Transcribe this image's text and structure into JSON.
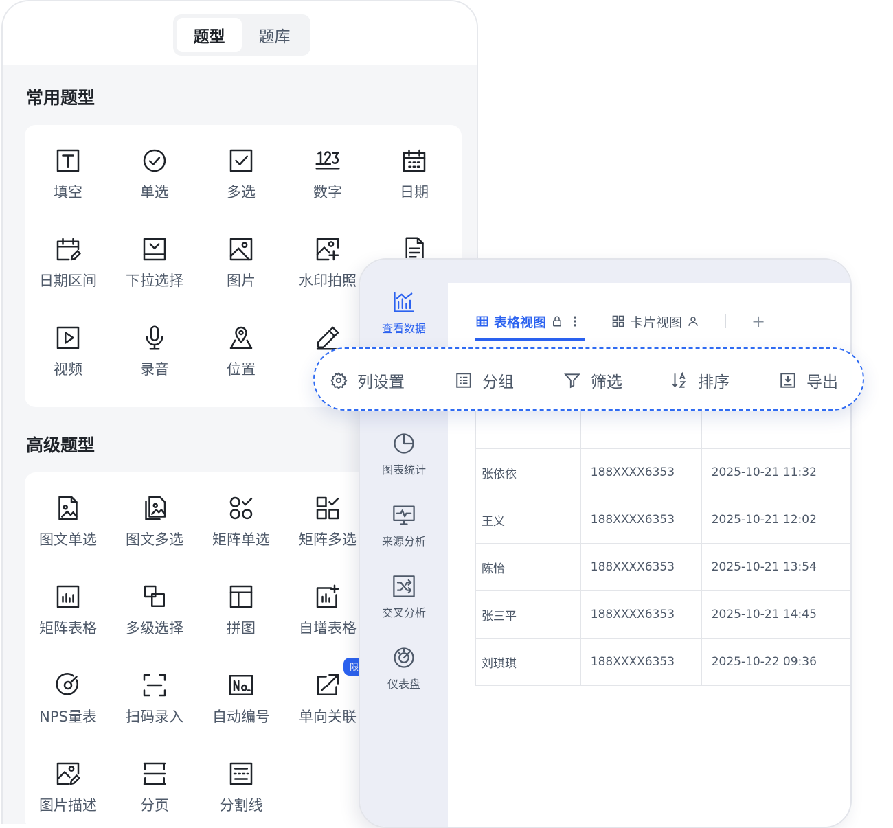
{
  "segmented": [
    "题型",
    "题库"
  ],
  "common": {
    "title": "常用题型",
    "items": [
      {
        "label": "填空",
        "icon": "text-icon"
      },
      {
        "label": "单选",
        "icon": "radio-check-icon"
      },
      {
        "label": "多选",
        "icon": "checkbox-icon"
      },
      {
        "label": "数字",
        "icon": "number-123-icon"
      },
      {
        "label": "日期",
        "icon": "calendar-icon"
      },
      {
        "label": "日期区间",
        "icon": "calendar-edit-icon"
      },
      {
        "label": "下拉选择",
        "icon": "dropdown-icon"
      },
      {
        "label": "图片",
        "icon": "image-icon"
      },
      {
        "label": "水印拍照",
        "icon": "watermark-photo-icon"
      },
      {
        "label": "",
        "icon": "document-icon"
      },
      {
        "label": "视频",
        "icon": "video-icon"
      },
      {
        "label": "录音",
        "icon": "microphone-icon"
      },
      {
        "label": "位置",
        "icon": "location-icon"
      },
      {
        "label": "",
        "icon": "pen-icon"
      }
    ]
  },
  "advanced": {
    "title": "高级题型",
    "badge": "限",
    "items": [
      {
        "label": "图文单选",
        "icon": "image-file-icon"
      },
      {
        "label": "图文多选",
        "icon": "image-files-icon"
      },
      {
        "label": "矩阵单选",
        "icon": "matrix-radio-icon"
      },
      {
        "label": "矩阵多选",
        "icon": "matrix-checkbox-icon"
      },
      {
        "label": "",
        "icon": ""
      },
      {
        "label": "矩阵表格",
        "icon": "bar-table-icon"
      },
      {
        "label": "多级选择",
        "icon": "cascade-icon"
      },
      {
        "label": "拼图",
        "icon": "layout-icon"
      },
      {
        "label": "自增表格",
        "icon": "chart-add-icon"
      },
      {
        "label": "",
        "icon": ""
      },
      {
        "label": "NPS量表",
        "icon": "gauge-icon"
      },
      {
        "label": "扫码录入",
        "icon": "scan-icon"
      },
      {
        "label": "自动编号",
        "icon": "number-no-icon"
      },
      {
        "label": "单向关联",
        "icon": "link-out-icon"
      },
      {
        "label": "",
        "icon": ""
      },
      {
        "label": "图片描述",
        "icon": "image-edit-icon"
      },
      {
        "label": "分页",
        "icon": "page-break-icon"
      },
      {
        "label": "分割线",
        "icon": "divider-line-icon"
      }
    ]
  },
  "sidebar": [
    {
      "label": "查看数据",
      "icon": "bar-chart-icon"
    },
    {
      "label": "图表统计",
      "icon": "pie-chart-icon"
    },
    {
      "label": "来源分析",
      "icon": "monitor-pulse-icon"
    },
    {
      "label": "交叉分析",
      "icon": "shuffle-icon"
    },
    {
      "label": "仪表盘",
      "icon": "dashboard-icon"
    }
  ],
  "views": {
    "table": "表格视图",
    "card": "卡片视图",
    "add": "+"
  },
  "toolbar": [
    "列设置",
    "分组",
    "筛选",
    "排序",
    "导出"
  ],
  "table_rows": [
    [
      "张依依",
      "188XXXX6353",
      "2025-10-21 11:32"
    ],
    [
      "王义",
      "188XXXX6353",
      "2025-10-21 12:02"
    ],
    [
      "陈怡",
      "188XXXX6353",
      "2025-10-21 13:54"
    ],
    [
      "张三平",
      "188XXXX6353",
      "2025-10-21 14:45"
    ],
    [
      "刘琪琪",
      "188XXXX6353",
      "2025-10-22 09:36"
    ]
  ],
  "colors": {
    "accent": "#2b62f0",
    "text": "#1f2329",
    "muted": "#4e5969",
    "panel": "#f5f6f8",
    "sidebar": "#eceef6"
  }
}
